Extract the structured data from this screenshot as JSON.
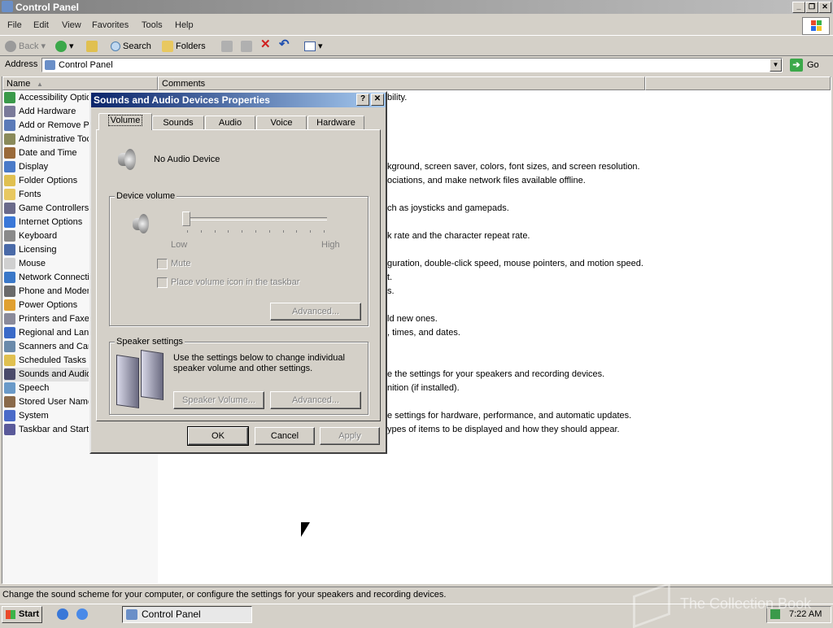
{
  "window": {
    "title": "Control Panel"
  },
  "menu": [
    "File",
    "Edit",
    "View",
    "Favorites",
    "Tools",
    "Help"
  ],
  "toolbar": {
    "back": "Back",
    "search": "Search",
    "folders": "Folders"
  },
  "address": {
    "label": "Address",
    "value": "Control Panel",
    "go": "Go"
  },
  "columns": {
    "name": "Name",
    "comments": "Comments"
  },
  "items": [
    {
      "name": "Accessibility Optio",
      "comment": "bility."
    },
    {
      "name": "Add Hardware",
      "comment": ""
    },
    {
      "name": "Add or Remove Pr",
      "comment": ""
    },
    {
      "name": "Administrative Toc",
      "comment": ""
    },
    {
      "name": "Date and Time",
      "comment": ""
    },
    {
      "name": "Display",
      "comment": "kground, screen saver, colors, font sizes, and screen resolution."
    },
    {
      "name": "Folder Options",
      "comment": "ociations, and make network files available offline."
    },
    {
      "name": "Fonts",
      "comment": ""
    },
    {
      "name": "Game Controllers",
      "comment": "ch as joysticks and gamepads."
    },
    {
      "name": "Internet Options",
      "comment": ""
    },
    {
      "name": "Keyboard",
      "comment": "k rate and the character repeat rate."
    },
    {
      "name": "Licensing",
      "comment": ""
    },
    {
      "name": "Mouse",
      "comment": "guration, double-click speed, mouse pointers, and motion speed."
    },
    {
      "name": "Network Connectic",
      "comment": "t."
    },
    {
      "name": "Phone and Modem",
      "comment": "s."
    },
    {
      "name": "Power Options",
      "comment": ""
    },
    {
      "name": "Printers and Faxes",
      "comment": "ld new ones."
    },
    {
      "name": "Regional and Lang",
      "comment": ", times, and dates."
    },
    {
      "name": "Scanners and Cam",
      "comment": ""
    },
    {
      "name": "Scheduled Tasks",
      "comment": ""
    },
    {
      "name": "Sounds and Audio",
      "comment": "e the settings for your speakers and recording devices."
    },
    {
      "name": "Speech",
      "comment": "nition (if installed)."
    },
    {
      "name": "Stored User Name",
      "comment": ""
    },
    {
      "name": "System",
      "comment": "e settings for hardware, performance, and automatic updates."
    },
    {
      "name": "Taskbar and Start",
      "comment": "ypes of items to be displayed and how they should appear."
    }
  ],
  "dialog": {
    "title": "Sounds and Audio Devices Properties",
    "help": "?",
    "close": "✕",
    "tabs": [
      "Volume",
      "Sounds",
      "Audio",
      "Voice",
      "Hardware"
    ],
    "device_name": "No Audio Device",
    "device_volume_label": "Device volume",
    "low": "Low",
    "high": "High",
    "volume_level": 0,
    "mute": "Mute",
    "place_icon": "Place volume icon in the taskbar",
    "advanced": "Advanced...",
    "speaker_settings_label": "Speaker settings",
    "speaker_desc": "Use the settings below to change individual speaker volume and other settings.",
    "speaker_volume": "Speaker Volume...",
    "advanced2": "Advanced...",
    "ok": "OK",
    "cancel": "Cancel",
    "apply": "Apply"
  },
  "status": "Change the sound scheme for your computer, or configure the settings for your speakers and recording devices.",
  "taskbar": {
    "start": "Start",
    "task": "Control Panel",
    "clock": "7:22 AM"
  },
  "watermark": "The Collection Book"
}
